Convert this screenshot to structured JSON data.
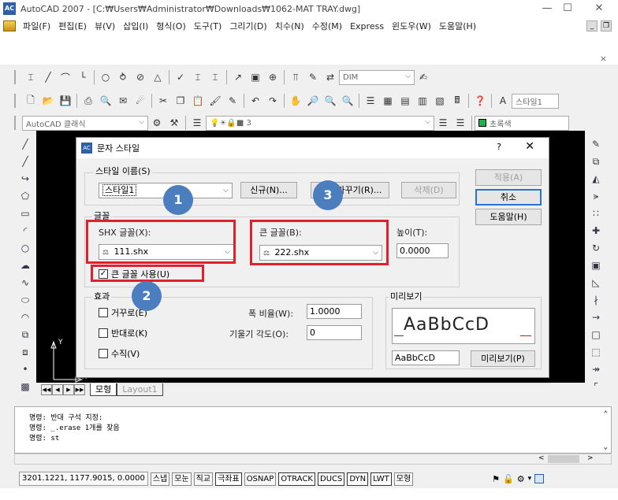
{
  "window": {
    "title": "AutoCAD 2007 - [C:₩Users₩Administrator₩Downloads₩1062-MAT TRAY.dwg]",
    "minimize": "—",
    "maximize": "☐",
    "close": "✕",
    "app_icon": "AC"
  },
  "menu": {
    "items": [
      "파일(F)",
      "편집(E)",
      "뷰(V)",
      "삽입(I)",
      "형식(O)",
      "도구(T)",
      "그리기(D)",
      "치수(N)",
      "수정(M)",
      "Express",
      "윈도우(W)",
      "도움말(H)"
    ],
    "mdi_min": "_",
    "mdi_restore": "❐",
    "mdi_close": "×"
  },
  "toolbar": {
    "dim_style_combo": "DIM",
    "text_style_combo": "스타일1",
    "workspace_combo": "AutoCAD 클래식",
    "layer_combo": "3",
    "color_combo": "초록색",
    "color_accent": "#22b14c"
  },
  "dialog": {
    "title": "문자 스타일",
    "help": "?",
    "close": "✕",
    "style_name_label": "스타일 이름(S)",
    "style_name_value": "스타일1",
    "new_button": "신규(N)...",
    "rename_button": "이름 바꾸기(R)...",
    "delete_button": "삭제(D)",
    "apply_button": "적용(A)",
    "cancel_button": "취소",
    "help_button": "도움말(H)",
    "font_group": "글꼴",
    "shx_font_label": "SHX 글꼴(X):",
    "shx_font_value": "111.shx",
    "big_font_label": "큰 글꼴(B):",
    "big_font_value": "222.shx",
    "height_label": "높이(T):",
    "height_value": "0.0000",
    "use_big_font_label": "큰 글꼴 사용(U)",
    "use_big_font_checked": true,
    "effects_group": "효과",
    "upside_down_label": "거꾸로(E)",
    "backwards_label": "반대로(K)",
    "vertical_label": "수직(V)",
    "width_factor_label": "폭 비율(W):",
    "width_factor_value": "1.0000",
    "oblique_label": "기울기 각도(O):",
    "oblique_value": "0",
    "preview_group": "미리보기",
    "preview_text": "AaBbCcD",
    "preview_input": "AaBbCcD",
    "preview_button": "미리보기(P)",
    "badges": [
      "1",
      "2",
      "3"
    ]
  },
  "canvas": {
    "tabs": [
      "모형",
      "Layout1"
    ],
    "ucs_x": "X",
    "ucs_y": "Y"
  },
  "command": {
    "lines": [
      "명령: 반대 구석 지정:",
      "명령: _.erase 1개를 찾음",
      "명령: st"
    ]
  },
  "status": {
    "coords": "3201.1221, 1177.9015, 0.0000",
    "buttons": [
      "스냅",
      "모눈",
      "직교",
      "극좌표",
      "OSNAP",
      "OTRACK",
      "DUCS",
      "DYN",
      "LWT",
      "모형"
    ],
    "active": [
      "극좌표",
      "OTRACK",
      "DUCS",
      "DYN",
      "LWT"
    ]
  }
}
